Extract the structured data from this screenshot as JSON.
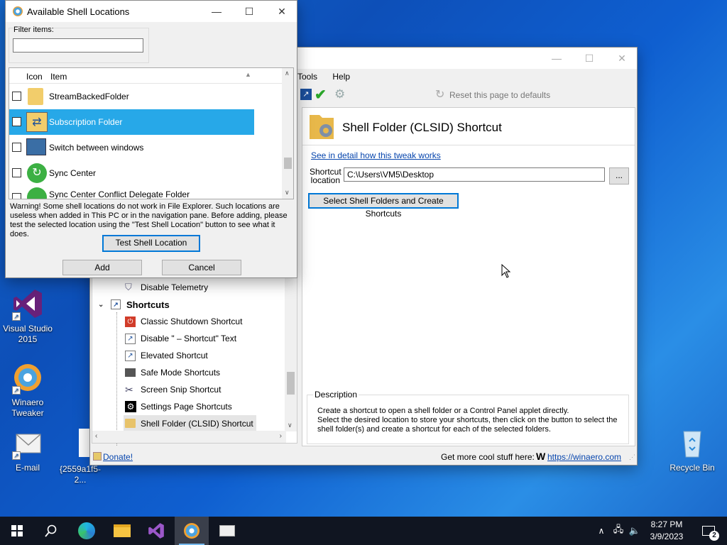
{
  "desktop": {
    "icons": [
      {
        "label": "Visual Studio 2015"
      },
      {
        "label": "Winaero Tweaker"
      },
      {
        "label": "E-mail"
      },
      {
        "label": "{2559a1f5-2..."
      },
      {
        "label": "Recycle Bin"
      }
    ]
  },
  "dialog": {
    "title": "Available Shell Locations",
    "filter_label": "Filter items:",
    "filter_value": "",
    "columns": {
      "icon": "Icon",
      "item": "Item"
    },
    "items": [
      {
        "label": "StreamBackedFolder",
        "selected": false
      },
      {
        "label": "Subscription Folder",
        "selected": true
      },
      {
        "label": "Switch between windows",
        "selected": false
      },
      {
        "label": "Sync Center",
        "selected": false
      },
      {
        "label": "Sync Center Conflict Delegate Folder",
        "selected": false
      }
    ],
    "warning": "Warning! Some shell locations do not work in File Explorer. Such locations are useless when added in This PC or in the navigation pane. Before adding, please test the selected location using the \"Test Shell Location\" button to see what it does.",
    "test_button": "Test Shell Location",
    "add_button": "Add",
    "cancel_button": "Cancel"
  },
  "tweaker": {
    "menu": {
      "tools": "Tools",
      "help": "Help"
    },
    "reset_label": "Reset this page to defaults",
    "tree": {
      "above_item": "Disable Telemetry",
      "category": "Shortcuts",
      "items": [
        "Classic Shutdown Shortcut",
        "Disable \" – Shortcut\" Text",
        "Elevated Shortcut",
        "Safe Mode Shortcuts",
        "Screen Snip Shortcut",
        "Settings Page Shortcuts",
        "Shell Folder (CLSID) Shortcut"
      ]
    },
    "page": {
      "title": "Shell Folder (CLSID) Shortcut",
      "detail_link": "See in detail how this tweak works",
      "shortcut_label_1": "Shortcut",
      "shortcut_label_2": "location",
      "shortcut_value": "C:\\Users\\VM5\\Desktop",
      "browse": "...",
      "create_button": "Select Shell Folders and Create Shortcuts",
      "description_title": "Description",
      "description_text": "Create a shortcut to open a shell folder or a Control Panel applet directly.\nSelect the desired location to store your shortcuts, then click on the button to select the shell folder(s) and create a shortcut for each of the selected folders."
    },
    "status": {
      "donate": "Donate!",
      "more": "Get more cool stuff here:",
      "url": "https://winaero.com"
    }
  },
  "taskbar": {
    "time": "8:27 PM",
    "date": "3/9/2023",
    "notif_count": "2"
  }
}
